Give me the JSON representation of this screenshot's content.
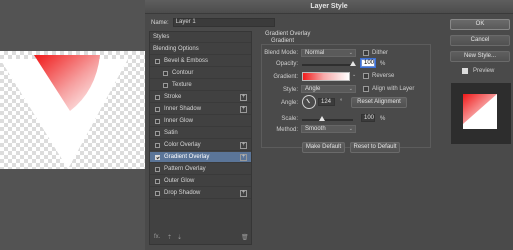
{
  "dialog": {
    "title": "Layer Style",
    "name_label": "Name:",
    "name_value": "Layer 1"
  },
  "styles_list": {
    "header": "Styles",
    "blending_options": "Blending Options",
    "items": [
      {
        "label": "Bevel & Emboss",
        "checked": false,
        "has_plus": false
      },
      {
        "label": "Contour",
        "checked": false,
        "has_plus": false,
        "indent": true
      },
      {
        "label": "Texture",
        "checked": false,
        "has_plus": false,
        "indent": true
      },
      {
        "label": "Stroke",
        "checked": false,
        "has_plus": true
      },
      {
        "label": "Inner Shadow",
        "checked": false,
        "has_plus": true
      },
      {
        "label": "Inner Glow",
        "checked": false,
        "has_plus": false
      },
      {
        "label": "Satin",
        "checked": false,
        "has_plus": false
      },
      {
        "label": "Color Overlay",
        "checked": false,
        "has_plus": true
      },
      {
        "label": "Gradient Overlay",
        "checked": true,
        "has_plus": true,
        "selected": true
      },
      {
        "label": "Pattern Overlay",
        "checked": false,
        "has_plus": false
      },
      {
        "label": "Outer Glow",
        "checked": false,
        "has_plus": false
      },
      {
        "label": "Drop Shadow",
        "checked": false,
        "has_plus": true
      }
    ],
    "footer": {
      "fx": "fx.",
      "up": "⇡",
      "down": "⇣",
      "trash": "🗑"
    }
  },
  "gradient_overlay": {
    "section_title": "Gradient Overlay",
    "group_title": "Gradient",
    "blend_mode_label": "Blend Mode:",
    "blend_mode_value": "Normal",
    "dither_label": "Dither",
    "opacity_label": "Opacity:",
    "opacity_value": "100",
    "opacity_unit": "%",
    "gradient_label": "Gradient:",
    "reverse_label": "Reverse",
    "style_label": "Style:",
    "style_value": "Angle",
    "align_label": "Align with Layer",
    "angle_label": "Angle:",
    "angle_value": "124",
    "angle_unit": "°",
    "reset_alignment": "Reset Alignment",
    "scale_label": "Scale:",
    "scale_value": "100",
    "scale_unit": "%",
    "method_label": "Method:",
    "method_value": "Smooth",
    "make_default": "Make Default",
    "reset_default": "Reset to Default"
  },
  "buttons": {
    "ok": "OK",
    "cancel": "Cancel",
    "new_style": "New Style...",
    "preview_label": "Preview"
  },
  "colors": {
    "gradient_start": "#f11c1c",
    "gradient_end": "#ffffff",
    "selection": "#5b7598"
  }
}
